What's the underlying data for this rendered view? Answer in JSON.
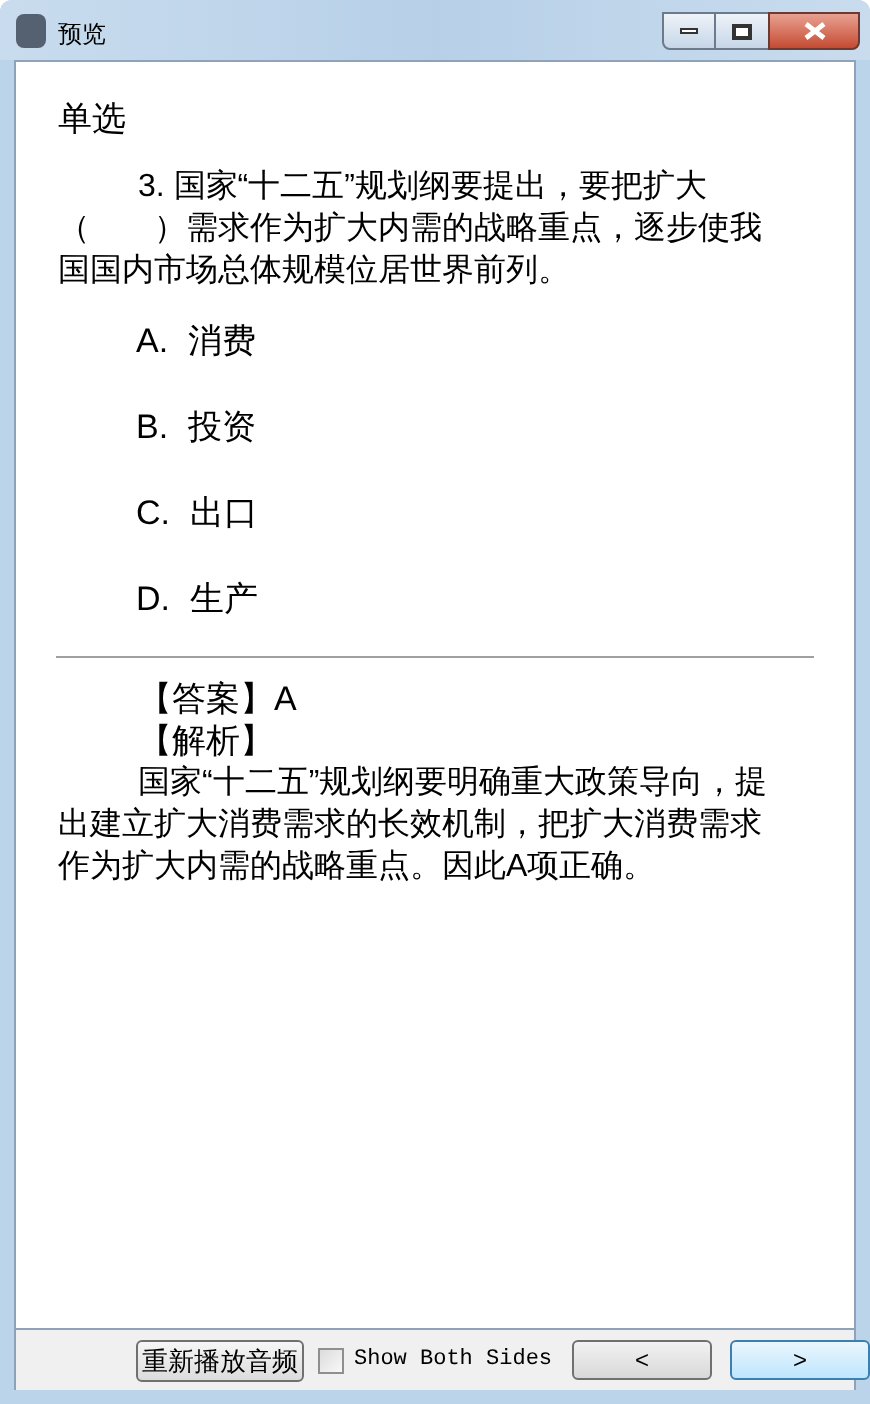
{
  "window": {
    "title": "预览"
  },
  "question": {
    "type": "单选",
    "text": "3. 国家“十二五”规划纲要提出，要把扩大（　　）需求作为扩大内需的战略重点，逐步使我国国内市场总体规模位居世界前列。",
    "options": [
      {
        "letter": "A.",
        "text": "消费"
      },
      {
        "letter": "B.",
        "text": "投资"
      },
      {
        "letter": "C.",
        "text": "出口"
      },
      {
        "letter": "D.",
        "text": "生产"
      }
    ]
  },
  "answer": {
    "answer_line": "【答案】A",
    "analysis_heading": "【解析】",
    "analysis": "国家“十二五”规划纲要明确重大政策导向，提出建立扩大消费需求的长效机制，把扩大消费需求作为扩大内需的战略重点。因此A项正确。"
  },
  "footer": {
    "replay_button": "重新播放音频",
    "show_both_sides": {
      "label": "Show Both Sides",
      "checked": false
    },
    "prev_button": "<",
    "next_button": ">"
  }
}
